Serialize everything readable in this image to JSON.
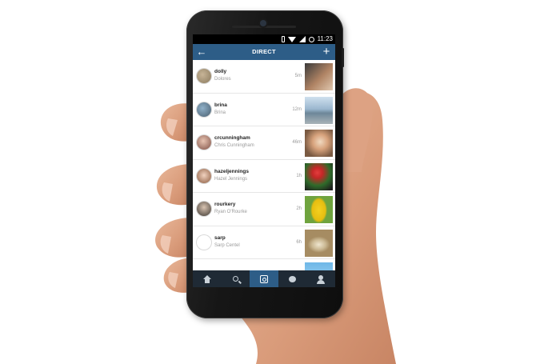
{
  "status_bar": {
    "time": "11:23"
  },
  "header": {
    "title": "DIRECT",
    "back_icon": "back-arrow-icon",
    "new_icon": "plus-icon"
  },
  "conversations": [
    {
      "username": "dolly",
      "full_name": "Dolores",
      "time": "5m"
    },
    {
      "username": "brina",
      "full_name": "Brina",
      "time": "12m"
    },
    {
      "username": "crcunningham",
      "full_name": "Chris Cunningham",
      "time": "46m"
    },
    {
      "username": "hazeljennings",
      "full_name": "Hazel Jennings",
      "time": "1h"
    },
    {
      "username": "rourkery",
      "full_name": "Ryan O'Rourke",
      "time": "2h"
    },
    {
      "username": "sarp",
      "full_name": "Sarp Centel",
      "time": "6h"
    }
  ],
  "nav": [
    "home-icon",
    "search-icon",
    "camera-icon",
    "activity-icon",
    "profile-icon"
  ],
  "colors": {
    "header": "#2d5d87",
    "navbar": "#1f2a35",
    "active_tab": "#2d5d87"
  }
}
